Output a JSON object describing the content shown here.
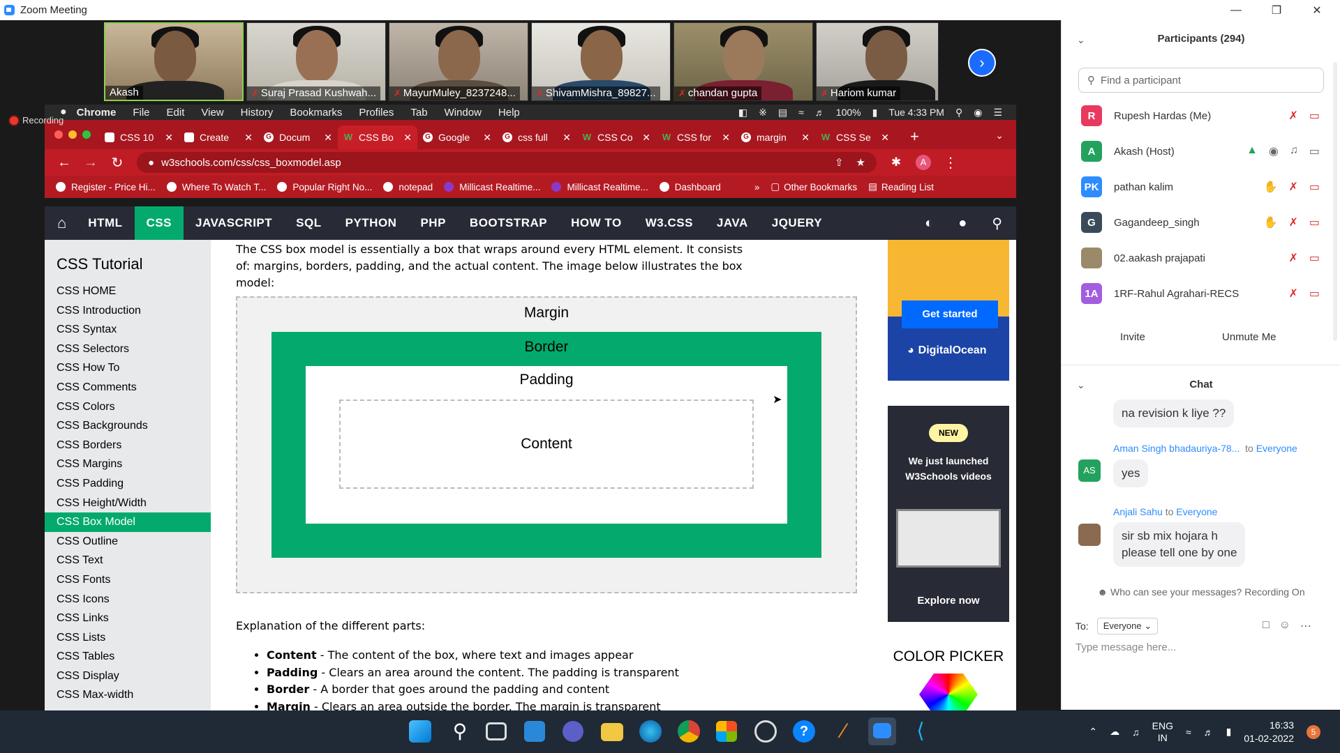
{
  "zoom": {
    "window_title": "Zoom Meeting",
    "recording_label": "Recording",
    "participants_header": "Participants (294)",
    "find_placeholder": "Find a participant",
    "invite_label": "Invite",
    "unmute_label": "Unmute Me",
    "chat_header": "Chat",
    "who_can_see": "Who can see your messages? Recording On",
    "to_label": "To:",
    "to_value": "Everyone",
    "message_placeholder": "Type message here..."
  },
  "videos": [
    {
      "name": "Akash",
      "muted": false
    },
    {
      "name": "Suraj Prasad Kushwah...",
      "muted": true
    },
    {
      "name": "MayurMuley_8237248...",
      "muted": true
    },
    {
      "name": "ShivamMishra_89827...",
      "muted": true
    },
    {
      "name": "chandan gupta",
      "muted": true
    },
    {
      "name": "Hariom kumar",
      "muted": true
    }
  ],
  "participants": [
    {
      "initials": "R",
      "name": "Rupesh Hardas (Me)",
      "color": "#e83a5f"
    },
    {
      "initials": "A",
      "name": "Akash (Host)",
      "color": "#23a25d"
    },
    {
      "initials": "PK",
      "name": "pathan kalim",
      "color": "#2d8cff"
    },
    {
      "initials": "G",
      "name": "Gagandeep_singh",
      "color": "#3b4a59"
    },
    {
      "initials": "",
      "name": "02.aakash prajapati",
      "color": "#9a8a6a"
    },
    {
      "initials": "1A",
      "name": "1RF-Rahul Agrahari-RECS",
      "color": "#a25de0"
    }
  ],
  "chat": {
    "msg1": "na revision k liye ??",
    "sender2": "Aman Singh bhadauriya-78...",
    "sender2_initials": "AS",
    "to2": "to",
    "target2": "Everyone",
    "msg2": "yes",
    "sender3": "Anjali Sahu",
    "to3": "to",
    "target3": "Everyone",
    "msg3_line1": "sir sb mix hojara h",
    "msg3_line2": "please tell one by one"
  },
  "mac_menubar": {
    "items": [
      "Chrome",
      "File",
      "Edit",
      "View",
      "History",
      "Bookmarks",
      "Profiles",
      "Tab",
      "Window",
      "Help"
    ],
    "battery": "100%",
    "time": "Tue 4:33 PM"
  },
  "tabs": [
    {
      "title": "CSS 10",
      "icon": "doc"
    },
    {
      "title": "Create",
      "icon": "doc"
    },
    {
      "title": "Docum",
      "icon": "g"
    },
    {
      "title": "CSS Bo",
      "icon": "w"
    },
    {
      "title": "Google",
      "icon": "g"
    },
    {
      "title": "css full",
      "icon": "g"
    },
    {
      "title": "CSS Co",
      "icon": "w"
    },
    {
      "title": "CSS for",
      "icon": "w"
    },
    {
      "title": "margin",
      "icon": "g"
    },
    {
      "title": "CSS Se",
      "icon": "w"
    }
  ],
  "address_url": "w3schools.com/css/css_boxmodel.asp",
  "avatar_letter": "A",
  "bookmarks": [
    "Register - Price Hi...",
    "Where To Watch T...",
    "Popular Right No...",
    "notepad",
    "Millicast Realtime...",
    "Millicast Realtime...",
    "Dashboard"
  ],
  "bookmarks_more": "»",
  "other_bookmarks": "Other Bookmarks",
  "reading_list": "Reading List",
  "w3nav": [
    "HTML",
    "CSS",
    "JAVASCRIPT",
    "SQL",
    "PYTHON",
    "PHP",
    "BOOTSTRAP",
    "HOW TO",
    "W3.CSS",
    "JAVA",
    "JQUERY"
  ],
  "sidebar": {
    "title": "CSS Tutorial",
    "items": [
      "CSS HOME",
      "CSS Introduction",
      "CSS Syntax",
      "CSS Selectors",
      "CSS How To",
      "CSS Comments",
      "CSS Colors",
      "CSS Backgrounds",
      "CSS Borders",
      "CSS Margins",
      "CSS Padding",
      "CSS Height/Width",
      "CSS Box Model",
      "CSS Outline",
      "CSS Text",
      "CSS Fonts",
      "CSS Icons",
      "CSS Links",
      "CSS Lists",
      "CSS Tables",
      "CSS Display",
      "CSS Max-width"
    ],
    "active": "CSS Box Model"
  },
  "content": {
    "intro": "The CSS box model is essentially a box that wraps around every HTML element. It consists of: margins, borders, padding, and the actual content. The image below illustrates the box model:",
    "diagram": {
      "margin": "Margin",
      "border": "Border",
      "padding": "Padding",
      "content": "Content"
    },
    "explain_heading": "Explanation of the different parts:",
    "parts": [
      {
        "term": "Content",
        "desc": " - The content of the box, where text and images appear"
      },
      {
        "term": "Padding",
        "desc": " - Clears an area around the content. The padding is transparent"
      },
      {
        "term": "Border",
        "desc": " - A border that goes around the padding and content"
      },
      {
        "term": "Margin",
        "desc": " - Clears an area outside the border. The margin is transparent"
      }
    ]
  },
  "ads": {
    "get_started": "Get started",
    "digitalocean": "DigitalOcean",
    "new_badge": "NEW",
    "launch_line1": "We just launched",
    "launch_line2": "W3Schools videos",
    "explore": "Explore now",
    "color_picker": "COLOR PICKER"
  },
  "taskbar": {
    "lang1": "ENG",
    "lang2": "IN",
    "time": "16:33",
    "date": "01-02-2022",
    "notif_count": "5"
  }
}
